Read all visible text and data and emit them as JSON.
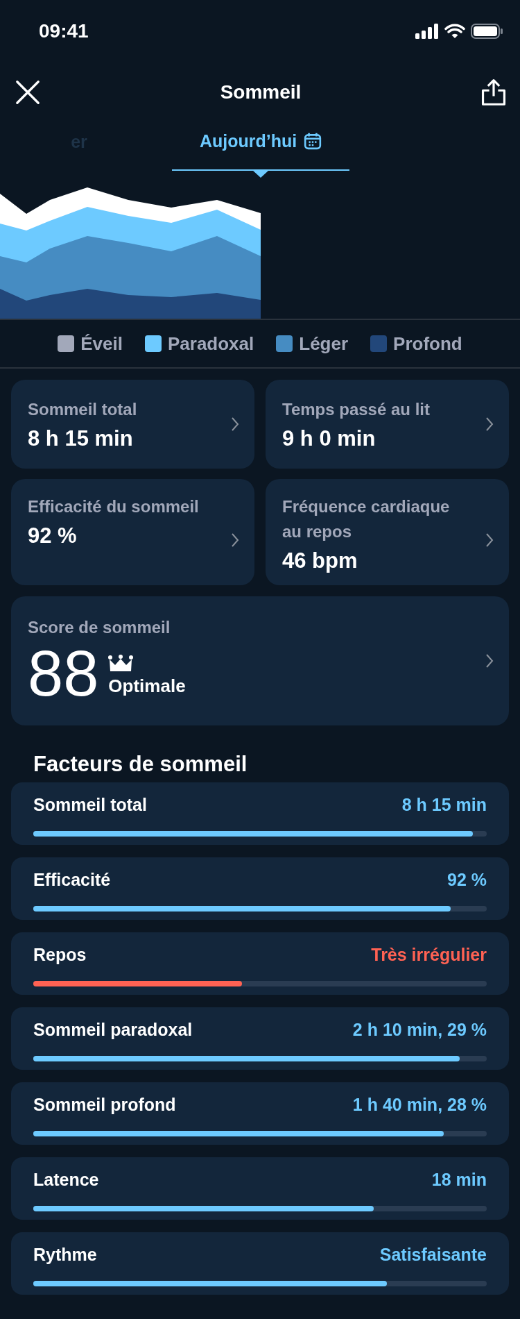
{
  "status_bar": {
    "time": "09:41"
  },
  "header": {
    "title": "Sommeil"
  },
  "tabs": [
    {
      "label": "er",
      "selected": false
    },
    {
      "label": "Aujourd’hui",
      "selected": true
    }
  ],
  "legend": [
    {
      "label": "Éveil",
      "color": "#a2a8ba"
    },
    {
      "label": "Paradoxal",
      "color": "#6dcaff"
    },
    {
      "label": "Léger",
      "color": "#468cc2"
    },
    {
      "label": "Profond",
      "color": "#22477a"
    }
  ],
  "summary_cards": [
    {
      "label": "Sommeil total",
      "value": "8 h 15 min"
    },
    {
      "label": "Temps passé au lit",
      "value": "9 h 0 min"
    },
    {
      "label": "Efficacité du sommeil",
      "value": "92 %"
    },
    {
      "label": "Fréquence cardiaque au repos",
      "value": "46 bpm"
    }
  ],
  "score_card": {
    "label": "Score de sommeil",
    "score": "88",
    "rating": "Optimale"
  },
  "factors": {
    "title": "Facteurs de sommeil",
    "items": [
      {
        "label": "Sommeil total",
        "value": "8 h 15 min",
        "level": 0.97,
        "color": "#6dcaff"
      },
      {
        "label": "Efficacité",
        "value": "92 %",
        "level": 0.92,
        "color": "#6dcaff"
      },
      {
        "label": "Repos",
        "value": "Très irrégulier",
        "level": 0.46,
        "color": "#ff6253"
      },
      {
        "label": "Sommeil paradoxal",
        "value": "2 h 10 min, 29 %",
        "level": 0.94,
        "color": "#6dcaff"
      },
      {
        "label": "Sommeil profond",
        "value": "1 h 40 min, 28 %",
        "level": 0.905,
        "color": "#6dcaff"
      },
      {
        "label": "Latence",
        "value": "18 min",
        "level": 0.75,
        "color": "#6dcaff"
      },
      {
        "label": "Rythme",
        "value": "Satisfaisante",
        "level": 0.78,
        "color": "#6dcaff"
      }
    ]
  }
}
